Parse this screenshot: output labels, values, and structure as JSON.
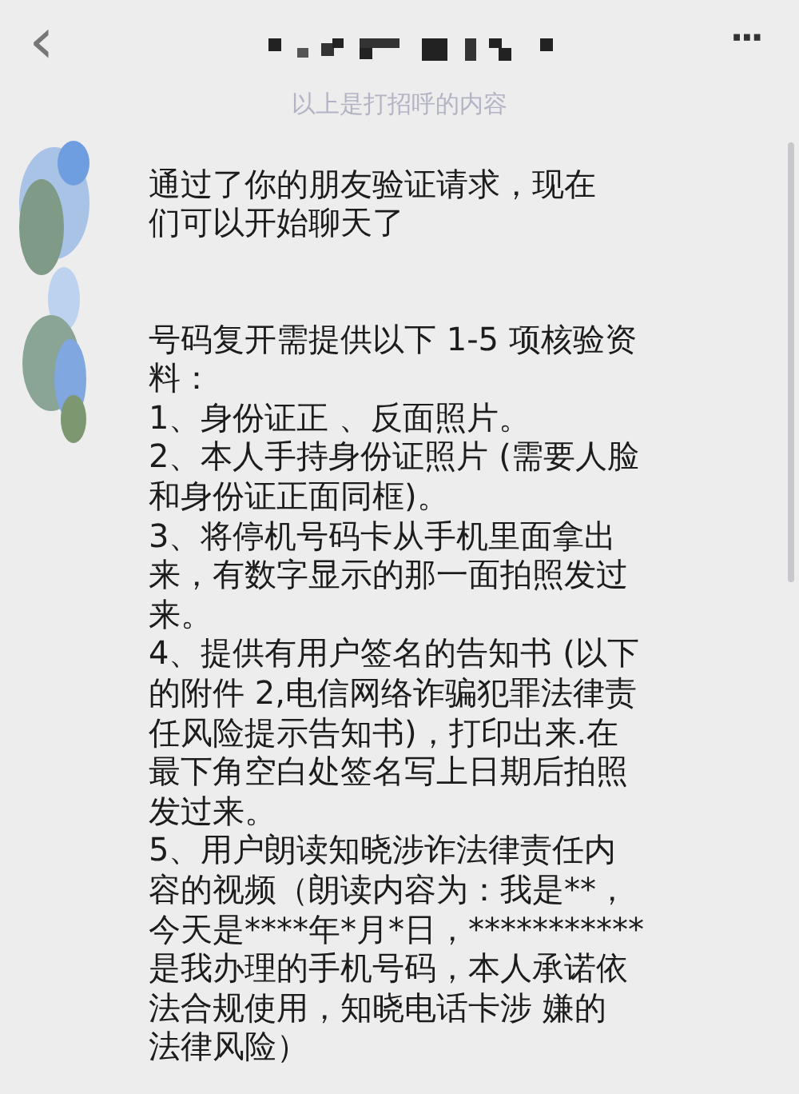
{
  "header": {
    "back": "‹",
    "more": "···"
  },
  "system_notice": "以上是打招呼的内容",
  "messages": [
    {
      "kind": "text",
      "paragraphs": [
        {
          "lines": [
            "通过了你的朋友验证请求，现在"
          ]
        },
        {
          "lines": [
            "们可以开始聊天了"
          ]
        }
      ]
    },
    {
      "kind": "text",
      "paragraphs": [
        {
          "lines": [
            "号码复开需提供以下 1-5 项核验资",
            "料："
          ]
        },
        {
          "lines": [
            "1、身份证正 、反面照片。"
          ]
        },
        {
          "lines": [
            "2、本人手持身份证照片 (需要人脸",
            "和身份证正面同框)。"
          ]
        },
        {
          "lines": [
            "3、将停机号码卡从手机里面拿出",
            "来，有数字显示的那一面拍照发过",
            "来。"
          ]
        },
        {
          "lines": [
            "4、提供有用户签名的告知书 (以下",
            "的附件 2,电信网络诈骗犯罪法律责",
            "任风险提示告知书)，打印出来.在",
            "最下角空白处签名写上日期后拍照",
            "发过来。"
          ]
        },
        {
          "lines": [
            "5、用户朗读知晓涉诈法律责任内",
            "容的视频（朗读内容为：我是**，",
            "今天是****年*月*日，***********",
            "是我办理的手机号码，本人承诺依",
            "法合规使用，知晓电话卡涉 嫌的",
            "法律风险）"
          ]
        }
      ]
    }
  ]
}
